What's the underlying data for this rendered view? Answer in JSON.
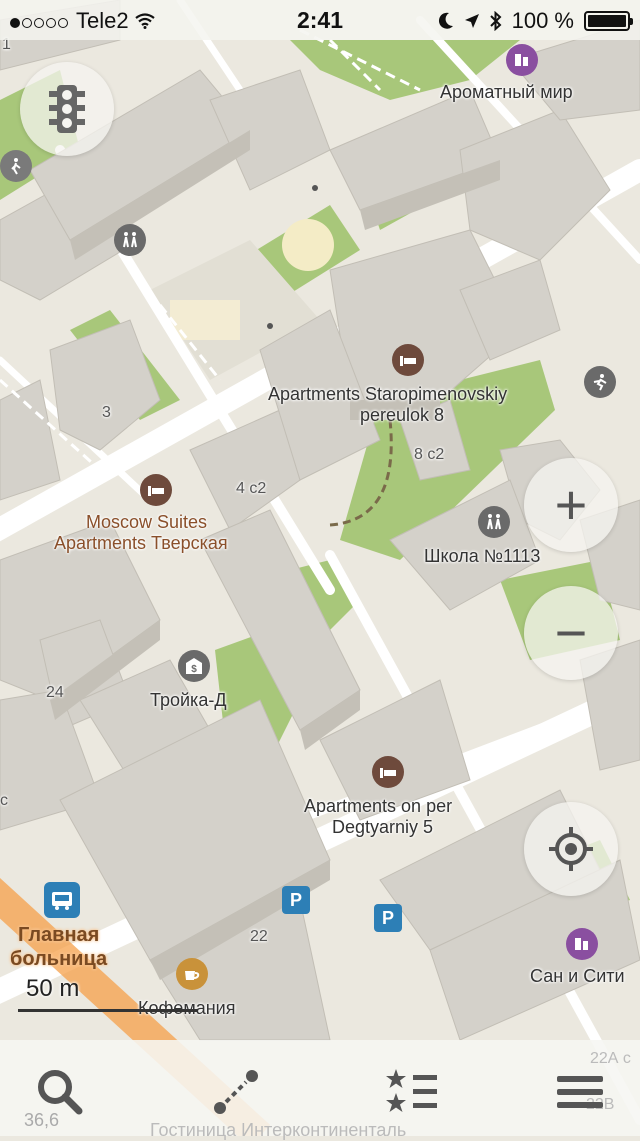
{
  "status_bar": {
    "carrier": "Tele2",
    "time": "2:41",
    "battery": "100 %",
    "icons": [
      "signal-dots",
      "wifi-icon",
      "moon-icon",
      "location-arrow-icon",
      "bluetooth-icon",
      "battery-icon"
    ]
  },
  "map": {
    "labels": {
      "aromatny_mir": "Ароматный мир",
      "apartments_staropimenovskiy_1": "Apartments Staropimenovskiy",
      "apartments_staropimenovskiy_2": "pereulok 8",
      "moscow_suites_1": "Moscow Suites",
      "moscow_suites_2": "Apartments Тверская",
      "school": "Школа №1113",
      "troika": "Тройка-Д",
      "apartments_degtyarniy_1": "Apartments on per",
      "apartments_degtyarniy_2": "Degtyarniy 5",
      "glavnaya_1": "Главная",
      "glavnaya_2": "больница",
      "kofemania": "Кофемания",
      "san_i_siti": "Сан и Сити",
      "gostinitsa": "Гостиница Интерконтиненталь",
      "temp": "36,6"
    },
    "house_numbers": {
      "n1": "1",
      "n3": "3",
      "n4c2": "4 с2",
      "n8c2": "8 с2",
      "n24": "24",
      "n22": "22",
      "n22a": "22А с",
      "n22v": "22В",
      "c_left": "с"
    },
    "parking_label": "P",
    "scale": "50 m",
    "colors": {
      "background": "#ebe8df",
      "building": "#d6d3cc",
      "park": "#a8c77a",
      "road": "#ffffff",
      "hotel_poi": "#6e4a3c",
      "parking": "#2d7fb6",
      "shop_poi": "#8a4fa0",
      "railway": "#f5a04a"
    }
  },
  "controls": {
    "traffic": "traffic-light-icon",
    "zoom_in": "+",
    "zoom_out": "−",
    "my_location": "crosshair-icon"
  },
  "toolbar": {
    "items": [
      "search-icon",
      "route-icon",
      "bookmarks-icon",
      "menu-icon"
    ]
  }
}
